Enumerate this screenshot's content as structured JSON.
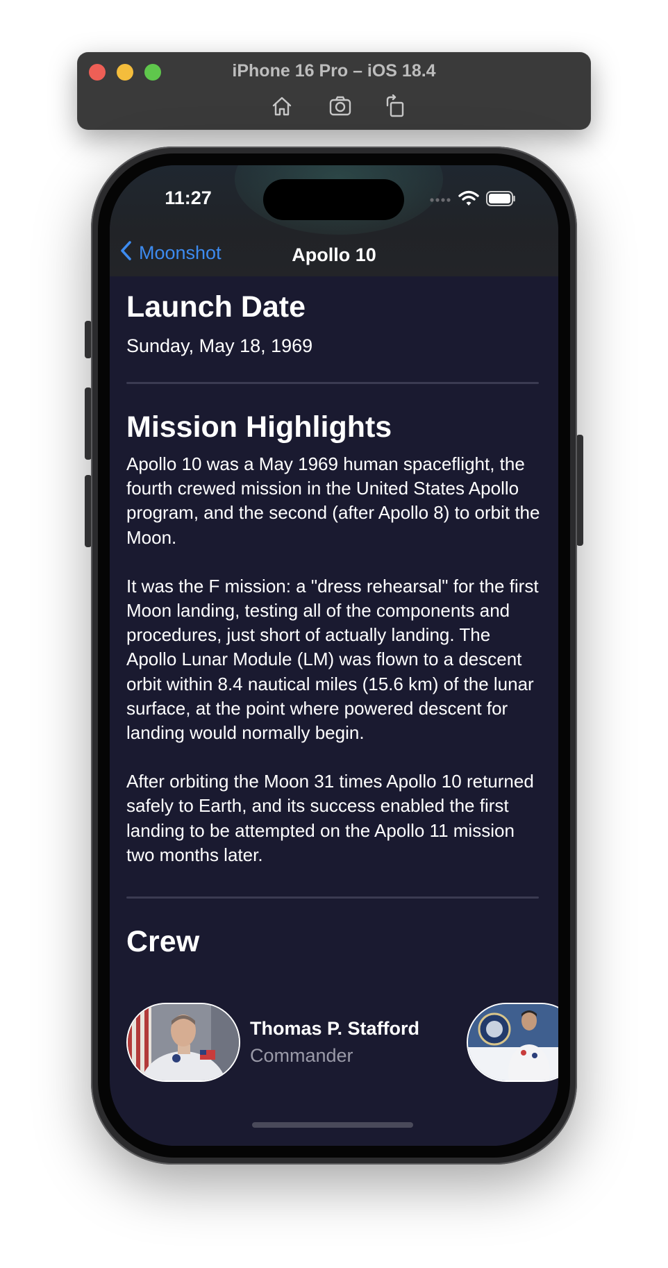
{
  "simulator": {
    "title": "iPhone 16 Pro – iOS 18.4",
    "tools": [
      "home-icon",
      "screenshot-icon",
      "rotate-icon"
    ]
  },
  "status_bar": {
    "time": "11:27",
    "icons": [
      "cellular-icon",
      "wifi-icon",
      "battery-icon"
    ]
  },
  "nav": {
    "back_label": "Moonshot",
    "title": "Apollo 10"
  },
  "launch": {
    "heading": "Launch Date",
    "date": "Sunday, May 18, 1969"
  },
  "highlights": {
    "heading": "Mission Highlights",
    "paragraphs": [
      "Apollo 10 was a May 1969 human spaceflight, the fourth crewed mission in the United States Apollo program, and the second (after Apollo 8) to orbit the Moon.",
      "It was the F mission: a \"dress rehearsal\" for the first Moon landing, testing all of the components and procedures, just short of actually landing. The Apollo Lunar Module (LM) was flown to a descent orbit within 8.4 nautical miles (15.6 km) of the lunar surface, at the point where powered descent for landing would normally begin.",
      "After orbiting the Moon 31 times Apollo 10 returned safely to Earth, and its success enabled the first landing to be attempted on the Apollo 11 mission two months later."
    ]
  },
  "crew": {
    "heading": "Crew",
    "members": [
      {
        "name": "Thomas P. Stafford",
        "role": "Commander"
      },
      {
        "name": "",
        "role": ""
      }
    ]
  },
  "colors": {
    "background": "#1a1a30",
    "accent": "#3d8bf0",
    "divider": "#3b3b52",
    "secondary_text": "#9a9aa8"
  }
}
